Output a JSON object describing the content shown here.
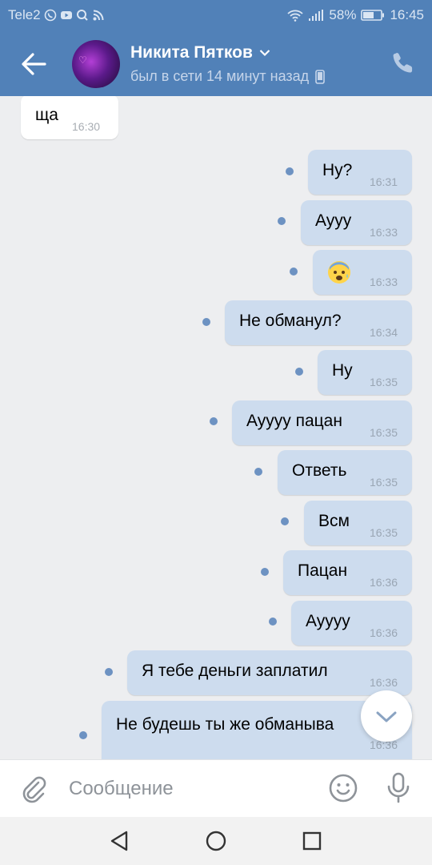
{
  "status_bar": {
    "carrier": "Tele2",
    "battery": "58%",
    "time": "16:45"
  },
  "header": {
    "name": "Никита Пятков",
    "status": "был в сети 14 минут назад"
  },
  "messages": [
    {
      "text": "ща",
      "time": "16:30",
      "direction": "in"
    },
    {
      "text": "Ну?",
      "time": "16:31",
      "direction": "out"
    },
    {
      "text": "Ауyy",
      "time": "16:33",
      "direction": "out"
    },
    {
      "text": "",
      "emoji": "anxious-face",
      "time": "16:33",
      "direction": "out"
    },
    {
      "text": "Не обманул?",
      "time": "16:34",
      "direction": "out"
    },
    {
      "text": "Ну",
      "time": "16:35",
      "direction": "out"
    },
    {
      "text": "Ауууу пацан",
      "time": "16:35",
      "direction": "out"
    },
    {
      "text": "Ответь",
      "time": "16:35",
      "direction": "out"
    },
    {
      "text": "Всм",
      "time": "16:35",
      "direction": "out"
    },
    {
      "text": "Пацан",
      "time": "16:36",
      "direction": "out"
    },
    {
      "text": "Ауууу",
      "time": "16:36",
      "direction": "out"
    },
    {
      "text": "Я тебе деньги заплатил",
      "time": "16:36",
      "direction": "out"
    },
    {
      "text": "Не будешь ты же обманыва",
      "time": "16:36",
      "direction": "out"
    }
  ],
  "composer": {
    "placeholder": "Сообщение"
  },
  "colors": {
    "header": "#5181b8",
    "outgoing_bubble": "#cddcee",
    "incoming_bubble": "#ffffff",
    "unread_dot": "#6d92c2",
    "background": "#edeef0"
  }
}
